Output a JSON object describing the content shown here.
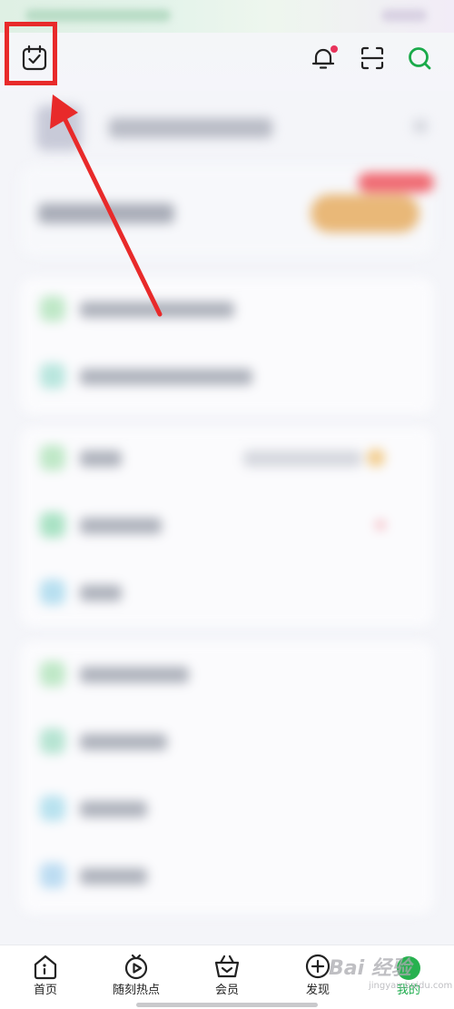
{
  "tabs": [
    {
      "label": "首页",
      "icon": "home-icon",
      "active": false
    },
    {
      "label": "随刻热点",
      "icon": "play-circle-icon",
      "active": false
    },
    {
      "label": "会员",
      "icon": "crown-basket-icon",
      "active": false
    },
    {
      "label": "发现",
      "icon": "plus-circle-icon",
      "active": false
    },
    {
      "label": "我的",
      "icon": "avatar-icon",
      "active": true
    }
  ],
  "watermark": {
    "main": "Bai 经验",
    "sub": "jingyan.baidu.com"
  },
  "colors": {
    "accent": "#1aaa4a",
    "notification_dot": "#e8335b",
    "highlight": "#e82a2a",
    "promo_button": "#e9b878",
    "promo_tag": "#f06b73"
  }
}
